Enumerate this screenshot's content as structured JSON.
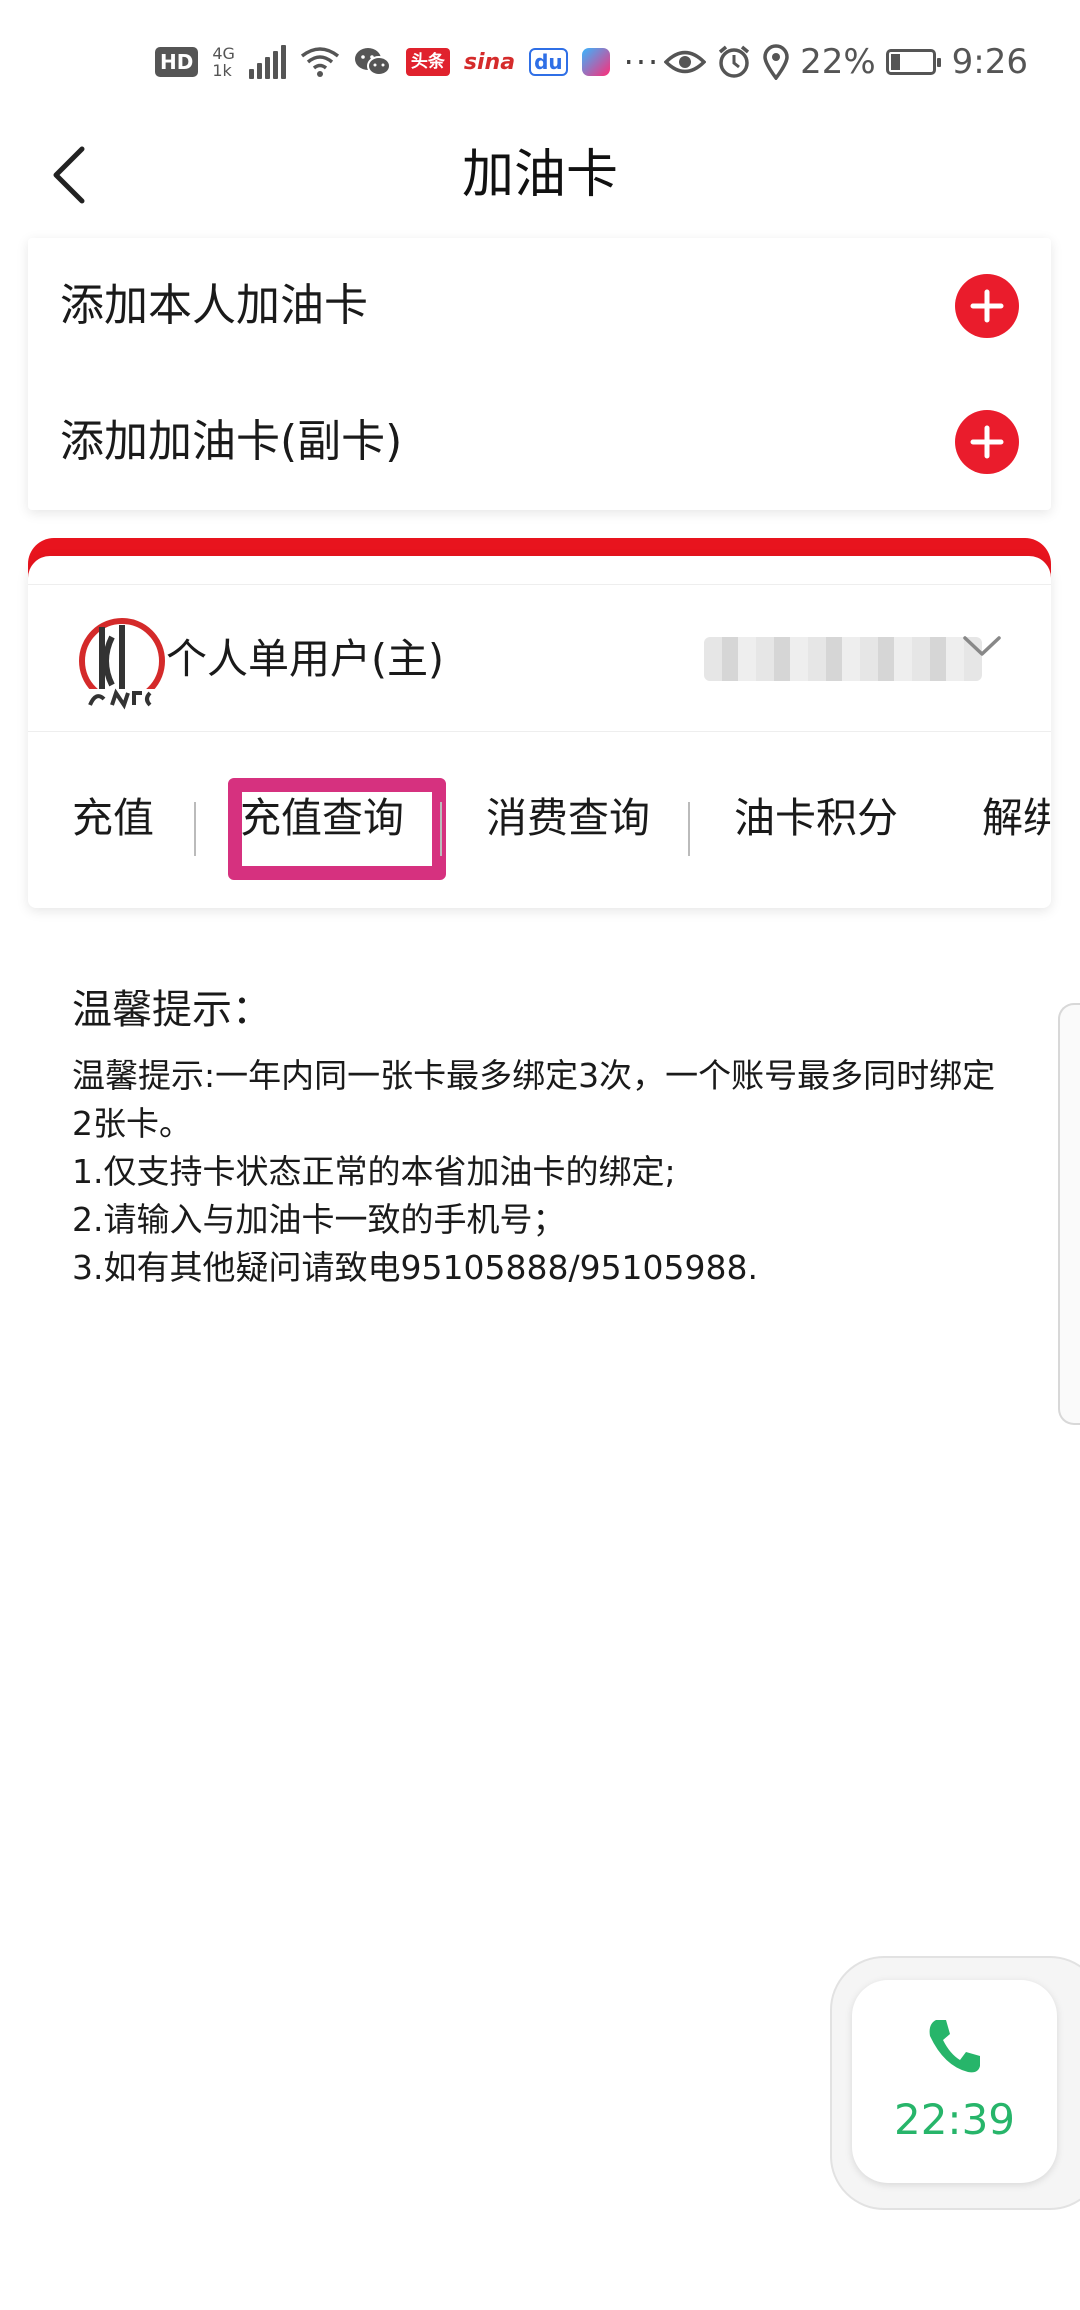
{
  "status_bar": {
    "hd": "HD",
    "network_top": "4G",
    "network_bottom": "1k",
    "toutiao": "头条",
    "sina": "sina",
    "baidu": "du",
    "more": "···",
    "battery_percent": "22%",
    "battery_level": 0.22,
    "time": "9:26"
  },
  "header": {
    "title": "加油卡"
  },
  "add_panel": {
    "add_own": "添加本人加油卡",
    "add_secondary": "添加加油卡(副卡)"
  },
  "card": {
    "user_type": "个人单用户(主)",
    "brand_color": "#e8141e"
  },
  "tabs": {
    "recharge": "充值",
    "recharge_query": "充值查询",
    "consume_query": "消费查询",
    "points": "油卡积分",
    "unbind": "解绑"
  },
  "tips": {
    "title": "温馨提示：",
    "line1": "温馨提示:一年内同一张卡最多绑定3次，一个账号最多同时绑定2张卡。",
    "line2": "1.仅支持卡状态正常的本省加油卡的绑定;",
    "line3": "2.请输入与加油卡一致的手机号；",
    "line4": "3.如有其他疑问请致电95105888/95105988."
  },
  "call": {
    "duration": "22:39",
    "color": "#27b56a"
  },
  "colors": {
    "accent_red": "#ea1c2c",
    "highlight_pink": "#d6317f"
  }
}
